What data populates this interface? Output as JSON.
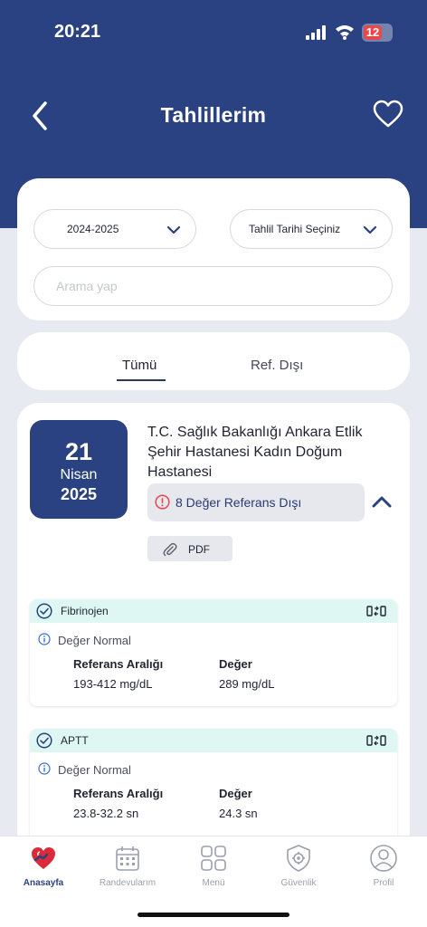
{
  "status_bar": {
    "time": "20:21",
    "battery": "12"
  },
  "header": {
    "title": "Tahlillerim"
  },
  "filters": {
    "year_select": "2024-2025",
    "date_select": "Tahlil Tarihi Seçiniz",
    "search_placeholder": "Arama yap"
  },
  "tabs": [
    {
      "label": "Tümü",
      "active": true
    },
    {
      "label": "Ref. Dışı",
      "active": false
    }
  ],
  "result": {
    "day": "21",
    "month": "Nisan",
    "year": "2025",
    "hospital": "T.C. Sağlık Bakanlığı Ankara Etlik Şehir Hastanesi Kadın Doğum Hastanesi",
    "alert": "8 Değer Referans Dışı",
    "pdf_label": "PDF",
    "tests": [
      {
        "name": "Fibrinojen",
        "status": "Değer Normal",
        "ref_label": "Referans Aralığı",
        "ref_value": "193-412 mg/dL",
        "value_label": "Değer",
        "value": "289 mg/dL"
      },
      {
        "name": "APTT",
        "status": "Değer Normal",
        "ref_label": "Referans Aralığı",
        "ref_value": "23.8-32.2 sn",
        "value_label": "Değer",
        "value": "24.3 sn"
      }
    ]
  },
  "bottom_nav": [
    {
      "label": "Anasayfa",
      "icon": "heart-hand-icon",
      "active": true
    },
    {
      "label": "Randevularım",
      "icon": "calendar-icon",
      "active": false
    },
    {
      "label": "Menü",
      "icon": "grid-icon",
      "active": false
    },
    {
      "label": "Güvenlik",
      "icon": "shield-gear-icon",
      "active": false
    },
    {
      "label": "Profil",
      "icon": "user-icon",
      "active": false
    }
  ],
  "colors": {
    "primary": "#2b4282",
    "alert": "#e8474b",
    "test_header": "#def7f3"
  }
}
